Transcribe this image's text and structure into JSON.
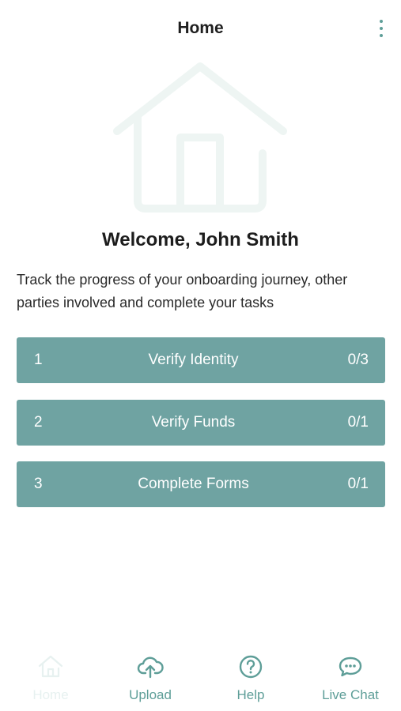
{
  "header": {
    "title": "Home"
  },
  "welcome": {
    "title": "Welcome, John Smith"
  },
  "description": "Track the progress of your onboarding journey, other parties involved and complete your tasks",
  "tasks": [
    {
      "number": "1",
      "label": "Verify Identity",
      "progress": "0/3"
    },
    {
      "number": "2",
      "label": "Verify Funds",
      "progress": "0/1"
    },
    {
      "number": "3",
      "label": "Complete Forms",
      "progress": "0/1"
    }
  ],
  "bottom_nav": [
    {
      "label": "Home",
      "icon": "home-icon",
      "active": true
    },
    {
      "label": "Upload",
      "icon": "upload-cloud-icon",
      "active": false
    },
    {
      "label": "Help",
      "icon": "help-icon",
      "active": false
    },
    {
      "label": "Live Chat",
      "icon": "chat-icon",
      "active": false
    }
  ],
  "colors": {
    "accent": "#6fa3a2",
    "nav_inactive": "#5e9e98",
    "nav_active": "#e7f1f0",
    "hero_icon": "#eef5f3"
  }
}
